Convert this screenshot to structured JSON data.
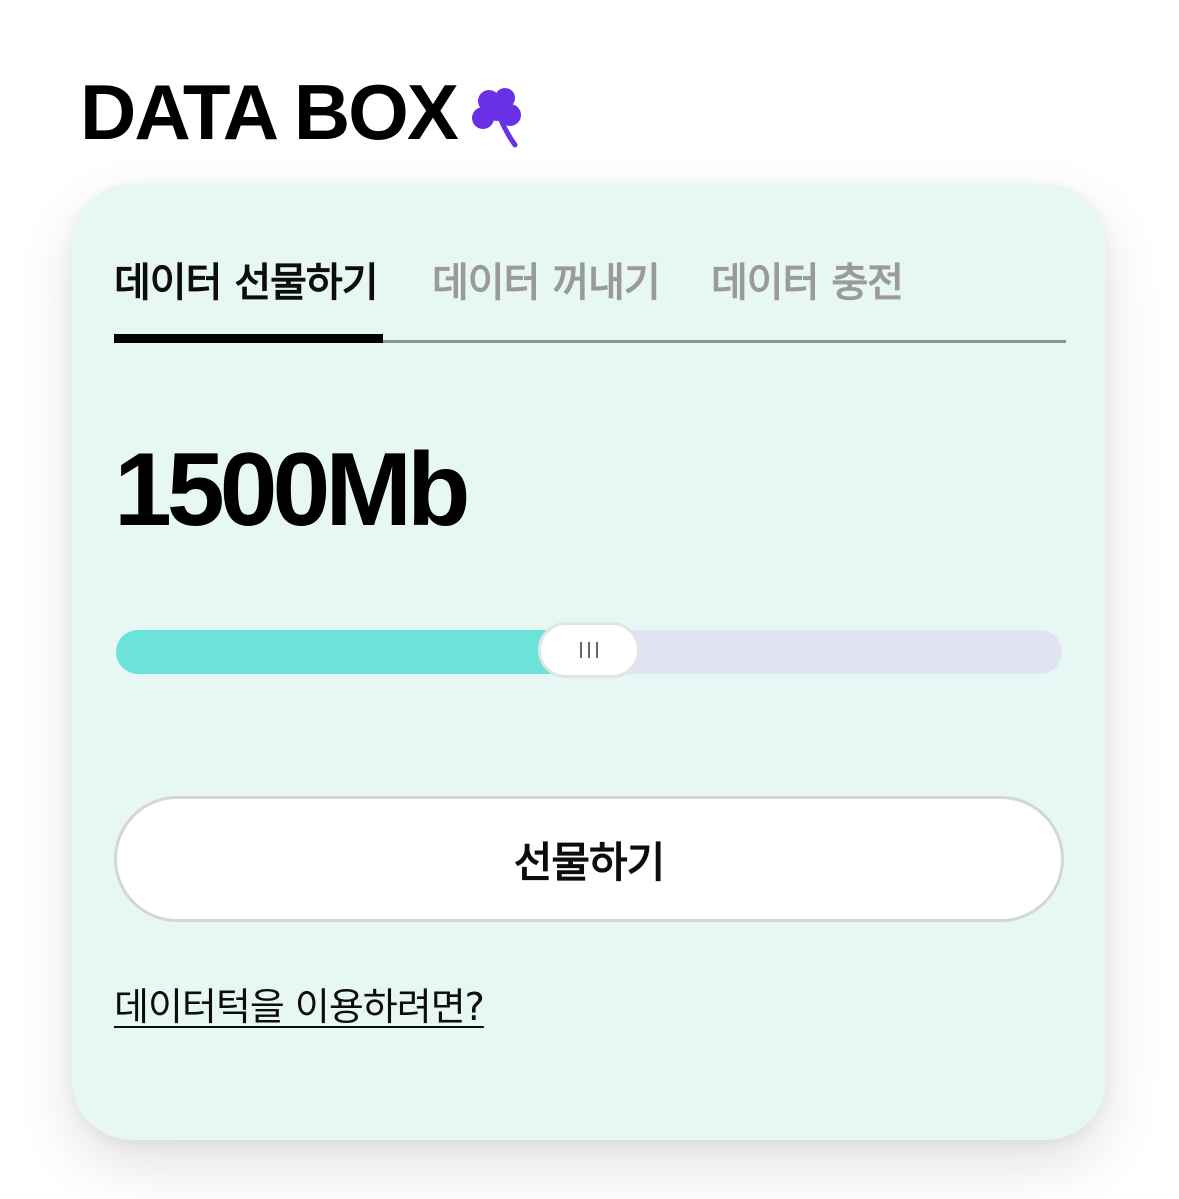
{
  "brand": {
    "title": "DATA BOX",
    "icon": "clover-icon",
    "icon_color": "#6a30e8"
  },
  "tabs": [
    {
      "label": "데이터 선물하기",
      "active": true
    },
    {
      "label": "데이터 꺼내기",
      "active": false
    },
    {
      "label": "데이터 충전",
      "active": false
    }
  ],
  "amount": {
    "value": "1500Mb"
  },
  "slider": {
    "fraction": 0.5,
    "fill_color": "#6ce3d8",
    "track_color": "#e0e3f1",
    "thumb_icon": "grip-icon"
  },
  "gift_button": {
    "label": "선물하기"
  },
  "help_link": {
    "label": "데이터턱을 이용하려면?"
  },
  "colors": {
    "card_background": "#e7f7f4",
    "text_primary": "#0d0d0d",
    "tab_inactive": "#9a9a9a"
  }
}
